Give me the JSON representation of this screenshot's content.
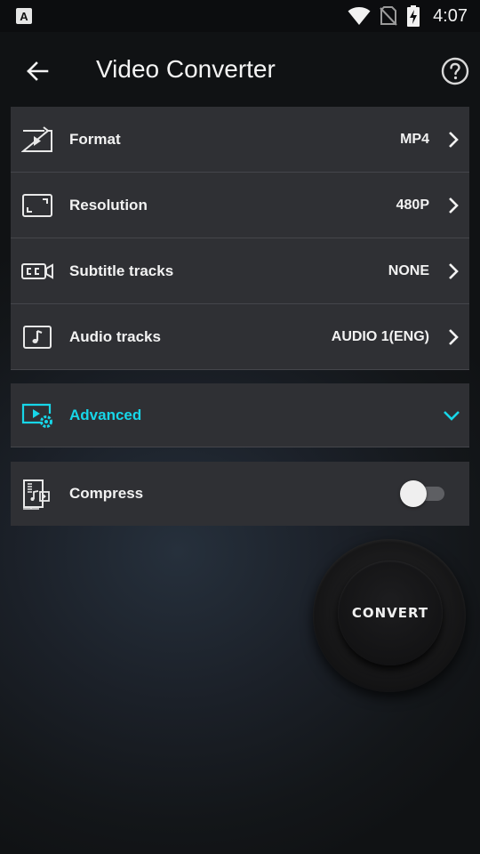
{
  "status_bar": {
    "time": "4:07",
    "app_icon_letter": "A"
  },
  "header": {
    "title": "Video Converter"
  },
  "settings": [
    {
      "label": "Format",
      "value": "MP4",
      "icon": "video-file-icon"
    },
    {
      "label": "Resolution",
      "value": "480P",
      "icon": "resolution-frame-icon"
    },
    {
      "label": "Subtitle tracks",
      "value": "NONE",
      "icon": "closed-caption-icon"
    },
    {
      "label": "Audio tracks",
      "value": "AUDIO 1(ENG)",
      "icon": "music-note-icon"
    }
  ],
  "advanced": {
    "label": "Advanced",
    "icon": "video-settings-icon",
    "expanded": false
  },
  "compress": {
    "label": "Compress",
    "icon": "compress-file-icon",
    "enabled": false
  },
  "convert": {
    "label": "CONVERT"
  },
  "colors": {
    "accent": "#17d6e8",
    "card": "#2f3034",
    "divider": "#45464b"
  }
}
